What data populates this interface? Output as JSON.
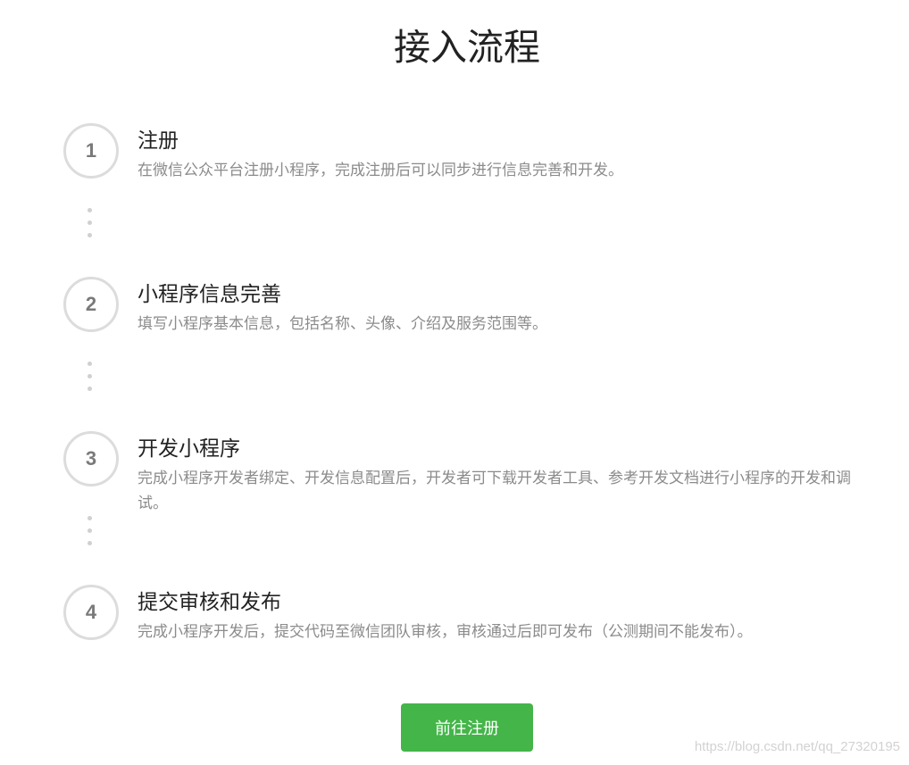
{
  "page": {
    "title": "接入流程"
  },
  "steps": [
    {
      "number": "1",
      "title": "注册",
      "description": "在微信公众平台注册小程序，完成注册后可以同步进行信息完善和开发。"
    },
    {
      "number": "2",
      "title": "小程序信息完善",
      "description": "填写小程序基本信息，包括名称、头像、介绍及服务范围等。"
    },
    {
      "number": "3",
      "title": "开发小程序",
      "description": "完成小程序开发者绑定、开发信息配置后，开发者可下载开发者工具、参考开发文档进行小程序的开发和调试。"
    },
    {
      "number": "4",
      "title": "提交审核和发布",
      "description": "完成小程序开发后，提交代码至微信团队审核，审核通过后即可发布（公测期间不能发布）。"
    }
  ],
  "actions": {
    "register_label": "前往注册"
  },
  "watermark": "https://blog.csdn.net/qq_27320195",
  "colors": {
    "accent": "#44b549",
    "circle_border": "#dcdcdc",
    "description_text": "#8b8b8b",
    "title_text": "#222222"
  }
}
